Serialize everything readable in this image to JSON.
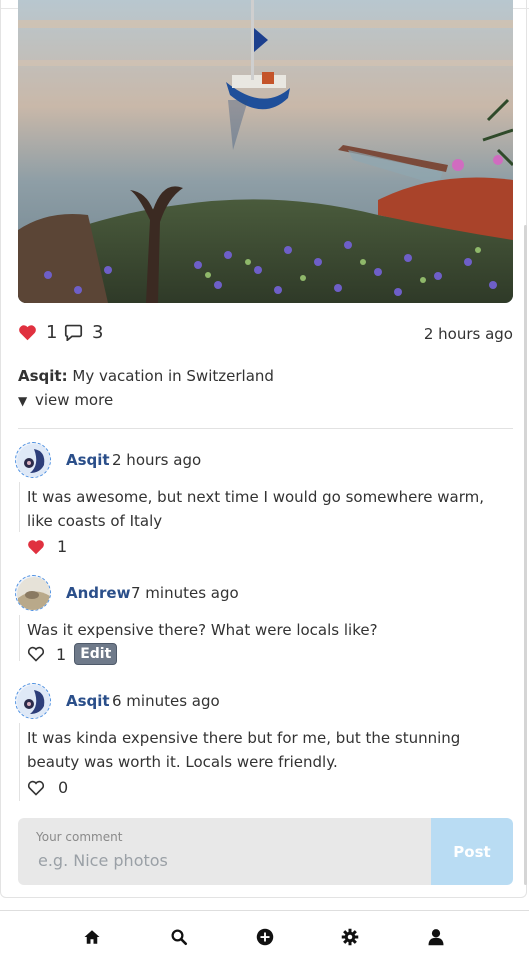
{
  "post": {
    "likes": "1",
    "comments_count": "3",
    "time": "2 hours ago",
    "author": "Asqit:",
    "caption": "My vacation in Switzerland",
    "view_more": "view more"
  },
  "comments": [
    {
      "author": "Asqit",
      "time": "2 hours ago",
      "text": "It was awesome, but next time I would go somewhere warm, like coasts of Italy",
      "likes": "1",
      "liked": true
    },
    {
      "author": "Andrew",
      "time": "7 minutes ago",
      "text": "Was it expensive there? What were locals like?",
      "likes": "1",
      "liked": false,
      "edit_label": "Edit"
    },
    {
      "author": "Asqit",
      "time": "6 minutes ago",
      "text": "It was kinda expensive there but for me, but the stunning beauty was worth it. Locals were friendly.",
      "likes": "0",
      "liked": false
    }
  ],
  "form": {
    "label": "Your comment",
    "placeholder": "e.g. Nice photos",
    "value": "",
    "post_label": "Post"
  },
  "nav": [
    "home-icon",
    "search-icon",
    "add-icon",
    "settings-icon",
    "profile-icon"
  ],
  "colors": {
    "like_red": "#e0313f",
    "accent_blue": "#2b4f8a",
    "post_button": "#b9dcf3"
  }
}
